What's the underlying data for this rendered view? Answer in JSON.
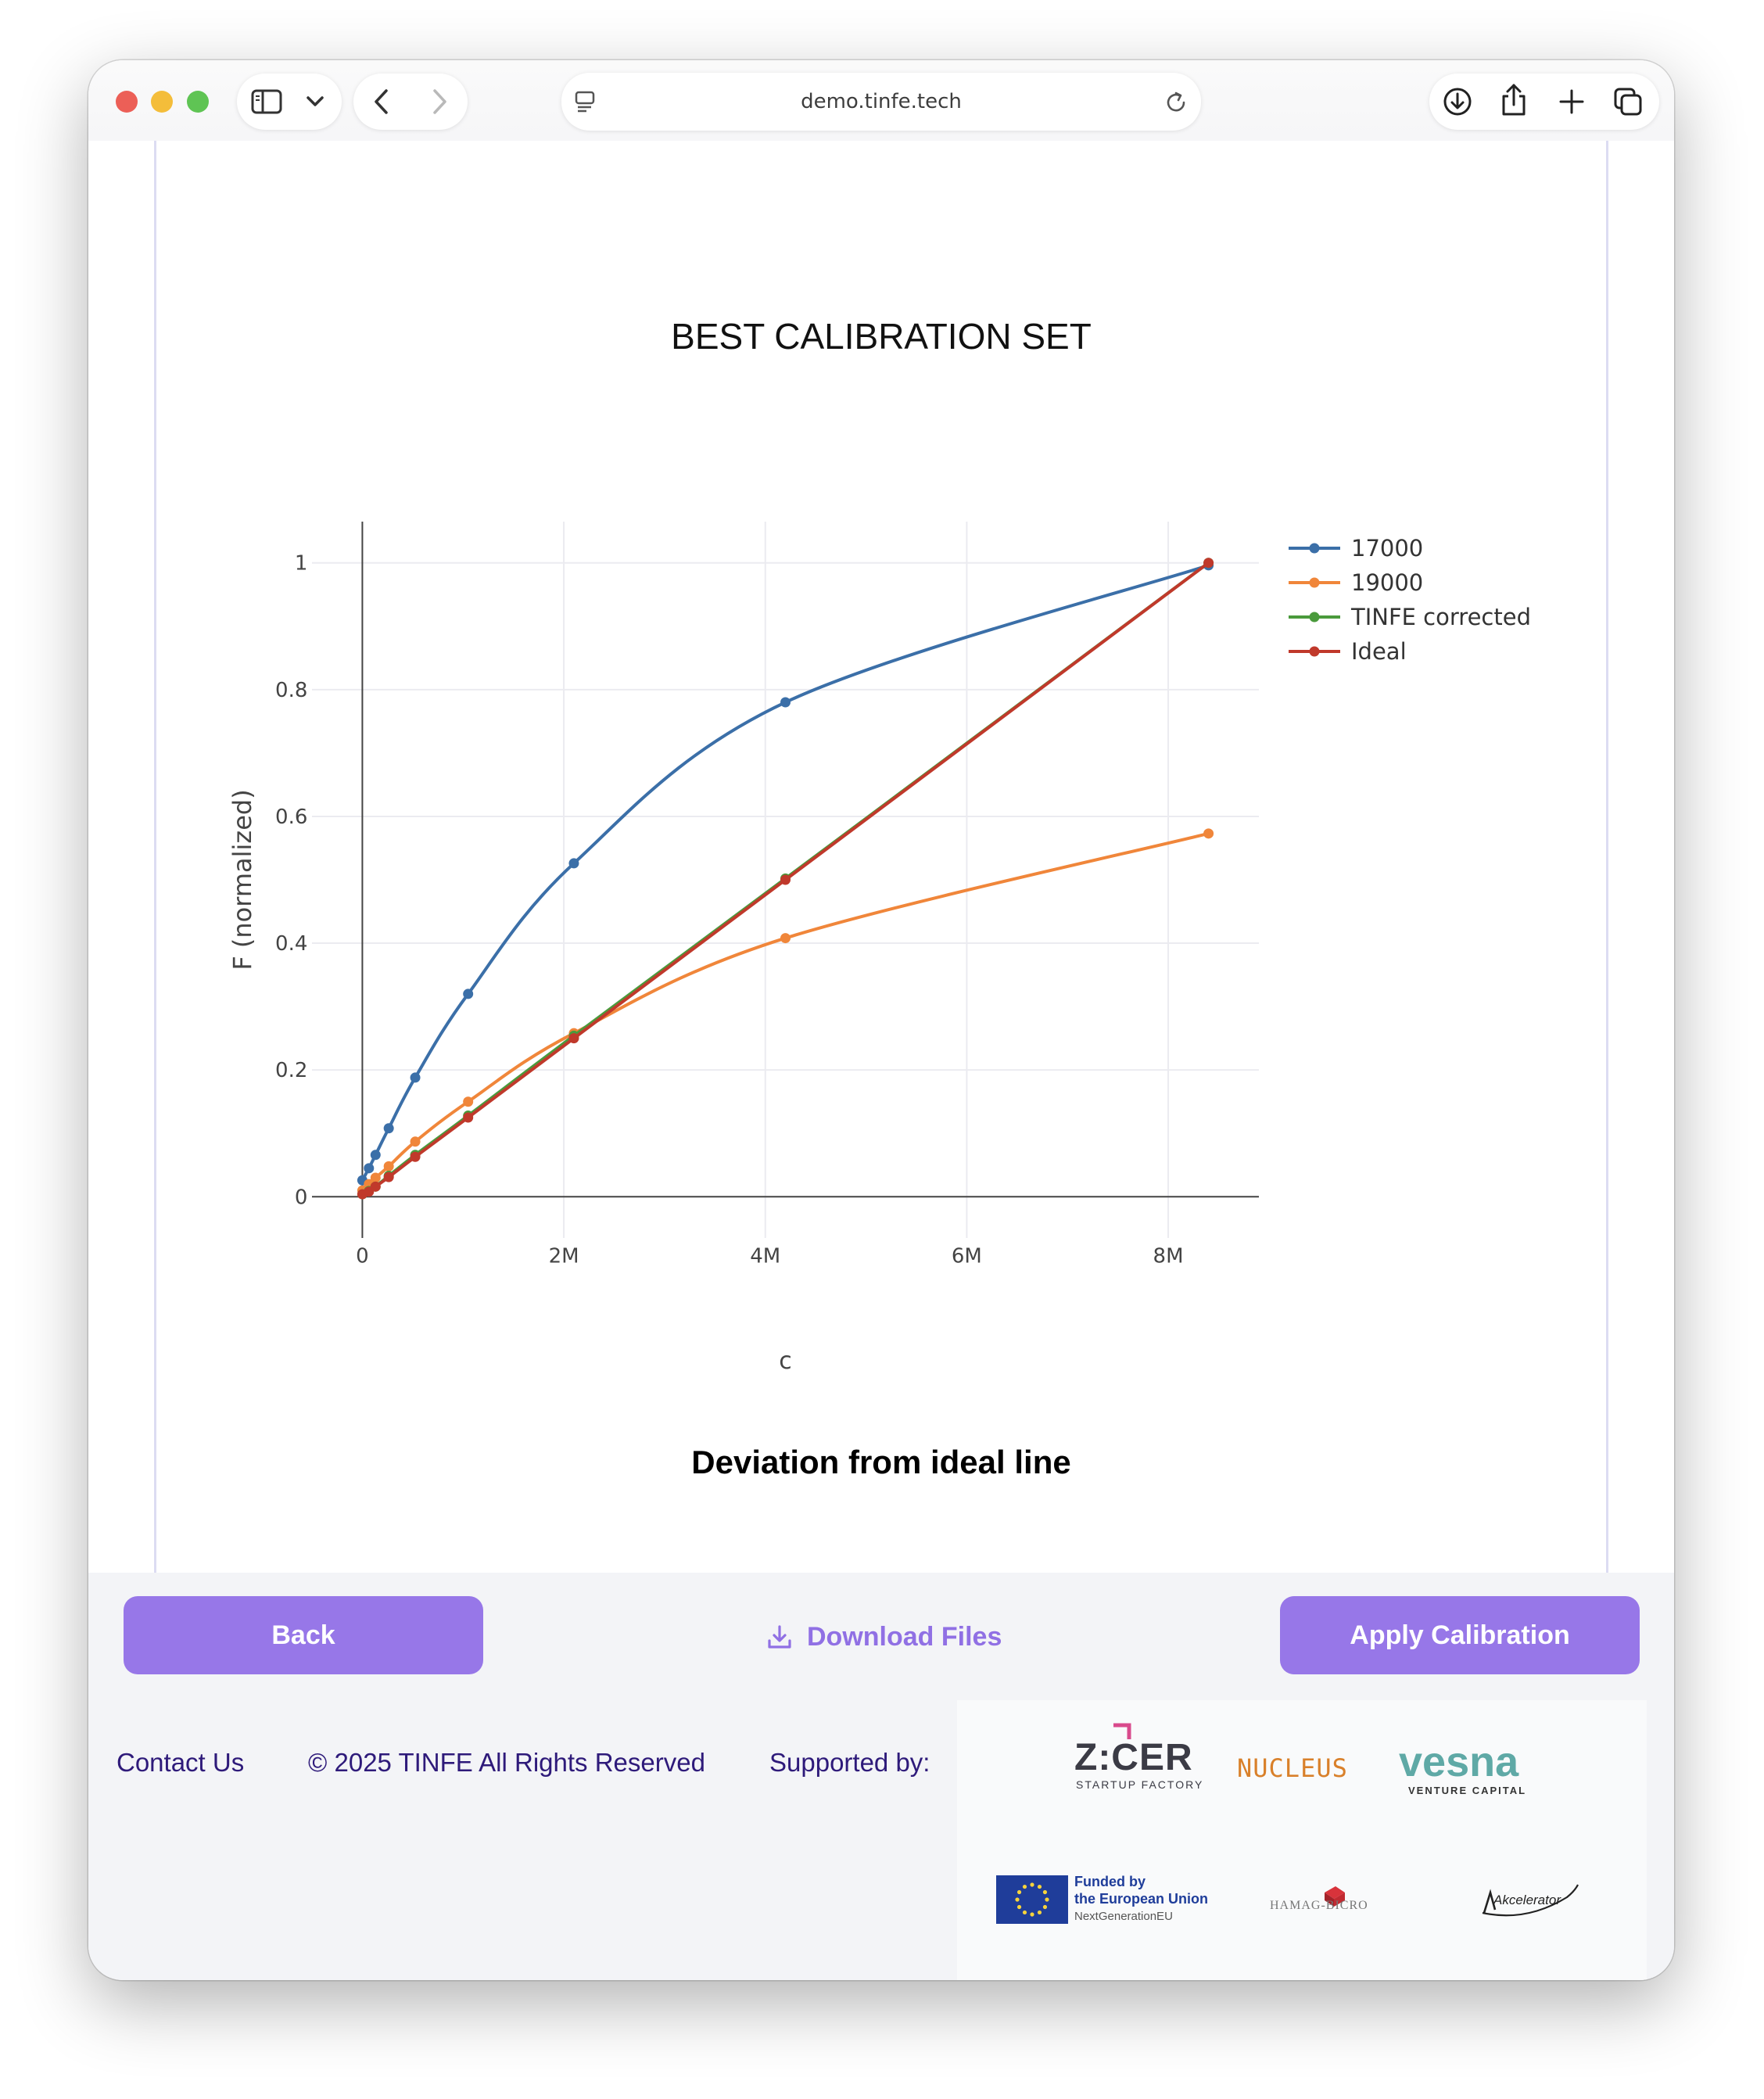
{
  "browser": {
    "url": "demo.tinfe.tech"
  },
  "chart": {
    "title": "BEST CALIBRATION SET",
    "subtitle": "Deviation from ideal line"
  },
  "chart_data": {
    "type": "line",
    "title": "BEST CALIBRATION SET",
    "xlabel": "c",
    "ylabel": "F (normalized)",
    "xlim": [
      -500000,
      8900000
    ],
    "ylim": [
      -0.065,
      1.065
    ],
    "x_ticks": [
      0,
      2000000,
      4000000,
      6000000,
      8000000
    ],
    "x_tick_labels": [
      "0",
      "2M",
      "4M",
      "6M",
      "8M"
    ],
    "y_ticks": [
      0,
      0.2,
      0.4,
      0.6,
      0.8,
      1
    ],
    "y_tick_labels": [
      "0",
      "0.2",
      "0.4",
      "0.6",
      "0.8",
      "1"
    ],
    "grid": true,
    "legend_position": "top-right",
    "series": [
      {
        "name": "17000",
        "color": "#3b6fa8",
        "x": [
          0,
          65000,
          131000,
          262000,
          525000,
          1050000,
          2100000,
          4200000,
          8400000
        ],
        "y": [
          0.026,
          0.045,
          0.066,
          0.108,
          0.188,
          0.32,
          0.526,
          0.78,
          0.996
        ]
      },
      {
        "name": "19000",
        "color": "#f0863a",
        "x": [
          0,
          65000,
          131000,
          262000,
          525000,
          1050000,
          2100000,
          4200000,
          8400000
        ],
        "y": [
          0.01,
          0.02,
          0.03,
          0.048,
          0.087,
          0.15,
          0.258,
          0.408,
          0.573
        ]
      },
      {
        "name": "TINFE corrected",
        "color": "#4a9a3c",
        "x": [
          0,
          65000,
          131000,
          262000,
          525000,
          1050000,
          2100000,
          4200000,
          8400000
        ],
        "y": [
          0.004,
          0.009,
          0.016,
          0.033,
          0.066,
          0.128,
          0.254,
          0.502,
          1.0
        ]
      },
      {
        "name": "Ideal",
        "color": "#c0392b",
        "x": [
          0,
          65000,
          131000,
          262000,
          525000,
          1050000,
          2100000,
          4200000,
          8400000
        ],
        "y": [
          0.004,
          0.008,
          0.016,
          0.031,
          0.063,
          0.125,
          0.25,
          0.5,
          1.0
        ]
      }
    ]
  },
  "actions": {
    "back_label": "Back",
    "download_label": "Download Files",
    "apply_label": "Apply Calibration"
  },
  "footer": {
    "contact": "Contact Us",
    "copyright": "© 2025 TINFE All Rights Reserved",
    "supported_by": "Supported by:"
  },
  "sponsors": {
    "zicer_name": "Z:CER",
    "zicer_tag": "STARTUP FACTORY",
    "nucleus": "NUCLEUS",
    "vesna": "vesna",
    "vesna_tag": "VENTURE CAPITAL",
    "eu_line1": "Funded by",
    "eu_line2": "the European Union",
    "eu_line3": "NextGenerationEU",
    "hamag": "HAMAG-BICRO",
    "akcelerator": "Akcelerator"
  },
  "colors": {
    "accent": "#9777e8",
    "footer_text": "#2e1a7a"
  }
}
